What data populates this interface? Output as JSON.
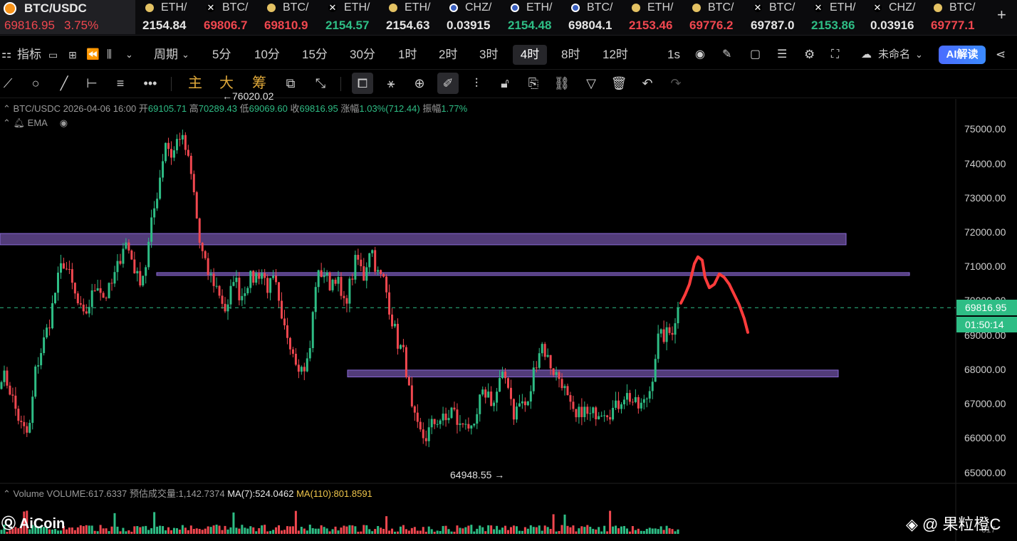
{
  "ticker": {
    "main": {
      "pair": "BTC/USDC",
      "price": "69816.95",
      "change": "3.75%"
    },
    "items": [
      {
        "name": "ETH/",
        "price": "2154.84",
        "icon": "eth-icon",
        "color": "wht"
      },
      {
        "name": "BTC/",
        "price": "69806.7",
        "icon": "btc-icon",
        "color": "red"
      },
      {
        "name": "BTC/",
        "price": "69810.9",
        "icon": "eth-icon",
        "color": "red"
      },
      {
        "name": "ETH/",
        "price": "2154.57",
        "icon": "btc-icon",
        "color": "grn"
      },
      {
        "name": "ETH/",
        "price": "2154.63",
        "icon": "eth-icon",
        "color": "wht"
      },
      {
        "name": "CHZ/",
        "price": "0.03915",
        "icon": "chz-icon",
        "color": "wht"
      },
      {
        "name": "ETH/",
        "price": "2154.48",
        "icon": "chz-icon",
        "color": "grn"
      },
      {
        "name": "BTC/",
        "price": "69804.1",
        "icon": "chz-icon",
        "color": "wht"
      },
      {
        "name": "ETH/",
        "price": "2153.46",
        "icon": "eth-icon",
        "color": "red"
      },
      {
        "name": "BTC/",
        "price": "69776.2",
        "icon": "eth-icon",
        "color": "red"
      },
      {
        "name": "BTC/",
        "price": "69787.0",
        "icon": "btc-icon",
        "color": "wht"
      },
      {
        "name": "ETH/",
        "price": "2153.86",
        "icon": "btc-icon",
        "color": "grn"
      },
      {
        "name": "CHZ/",
        "price": "0.03916",
        "icon": "btc-icon",
        "color": "wht"
      },
      {
        "name": "BTC/",
        "price": "69777.1",
        "icon": "eth-icon",
        "color": "red"
      }
    ],
    "add": "+"
  },
  "toolbar": {
    "indicators": "指标",
    "period": "周期",
    "intervals": [
      "5分",
      "10分",
      "15分",
      "30分",
      "1时",
      "2时",
      "3时",
      "4时",
      "8时",
      "12时"
    ],
    "selected": "4时",
    "sec": "1s",
    "layout_name": "未命名",
    "ai": "AI解读"
  },
  "drawbar": {
    "main": "主",
    "big": "大",
    "chip": "筹"
  },
  "info": {
    "pair": "BTC/USDC",
    "date": "2026-04-06 16:00",
    "open_l": "开",
    "open": "69105.71",
    "high_l": "高",
    "high": "70289.43",
    "low_l": "低",
    "low": "69069.60",
    "close_l": "收",
    "close": "69816.95",
    "chg_l": "涨幅",
    "chg": "1.03%(712.44)",
    "amp_l": "振幅",
    "amp": "1.77%"
  },
  "ema": "EMA",
  "chart_data": {
    "type": "candlestick",
    "title": "BTC/USDC",
    "ylim": [
      64700,
      75900
    ],
    "yticks": [
      "75000.00",
      "74000.00",
      "73000.00",
      "72000.00",
      "71000.00",
      "70000.00",
      "69000.00",
      "68000.00",
      "67000.00",
      "66000.00",
      "65000.00"
    ],
    "last_price": "69816.95",
    "countdown": "01:50:14",
    "high_marker": "76020.02",
    "low_marker": "64948.55",
    "zones": [
      {
        "low": 71650,
        "high": 71980
      },
      {
        "low": 70760,
        "high": 70840
      },
      {
        "low": 67800,
        "high": 68000
      }
    ],
    "close_path": [
      67900,
      67600,
      66900,
      66300,
      66100,
      68000,
      68700,
      69400,
      70400,
      71200,
      70700,
      70000,
      69500,
      70000,
      70600,
      70100,
      70400,
      71000,
      71800,
      71300,
      70600,
      70900,
      72300,
      73400,
      74700,
      74200,
      74900,
      74400,
      73400,
      71700,
      70900,
      70600,
      70200,
      69600,
      70800,
      70100,
      70600,
      70700,
      70900,
      70400,
      70600,
      69300,
      69000,
      68400,
      68000,
      68300,
      70600,
      70900,
      70500,
      70800,
      69800,
      70500,
      71300,
      70700,
      71700,
      70800,
      70600,
      69600,
      68800,
      68400,
      66800,
      66200,
      66000,
      66400,
      66600,
      66500,
      66900,
      66300,
      66600,
      66000,
      67100,
      67400,
      67000,
      67700,
      67800,
      66700,
      67100,
      66900,
      68100,
      68800,
      68300,
      67900,
      67700,
      67000,
      66500,
      66900,
      66600,
      66800,
      66900,
      66800,
      66900,
      67300,
      67200,
      66900,
      67000,
      67500,
      68900,
      69000,
      69100,
      69800
    ]
  },
  "volume": {
    "label": "Volume",
    "volume": "VOLUME:617.6337",
    "est": "预估成交量:1,142.7374",
    "ma7": "MA(7):524.0462",
    "ma110": "MA(110):801.8591",
    "tag": "617"
  },
  "watermark": {
    "logo": "AiCoin",
    "user": "果粒橙C"
  },
  "colors": {
    "up": "#2ebd85",
    "down": "#f0474f",
    "zone": "#8a6ad8",
    "annotation": "#ff3b3b"
  }
}
